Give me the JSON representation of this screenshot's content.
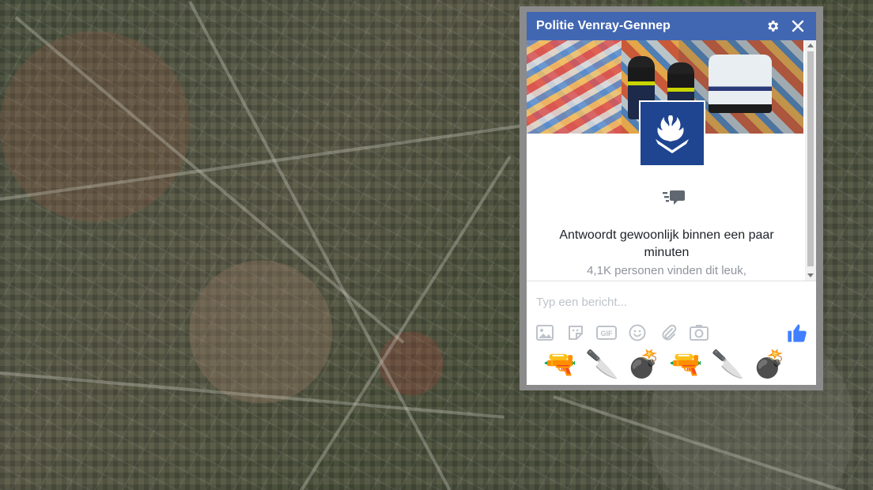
{
  "chat": {
    "title": "Politie Venray-Gennep",
    "response_time": "Antwoordt gewoonlijk binnen een paar minuten",
    "likes": "4,1K personen vinden dit leuk,",
    "input_placeholder": "Typ een bericht...",
    "header_color": "#4267b2",
    "logo_color": "#1f4591",
    "icons": {
      "settings": "gear-icon",
      "close": "close-icon",
      "response": "response-time-icon",
      "toolbar": [
        "image-icon",
        "sticker-icon",
        "gif-icon",
        "emoji-icon",
        "attachment-icon",
        "camera-icon"
      ],
      "like": "thumbs-up-icon"
    },
    "gif_label": "GIF"
  },
  "emojis": [
    "🔫",
    "🔪",
    "💣",
    "🔫",
    "🔪",
    "💣"
  ]
}
